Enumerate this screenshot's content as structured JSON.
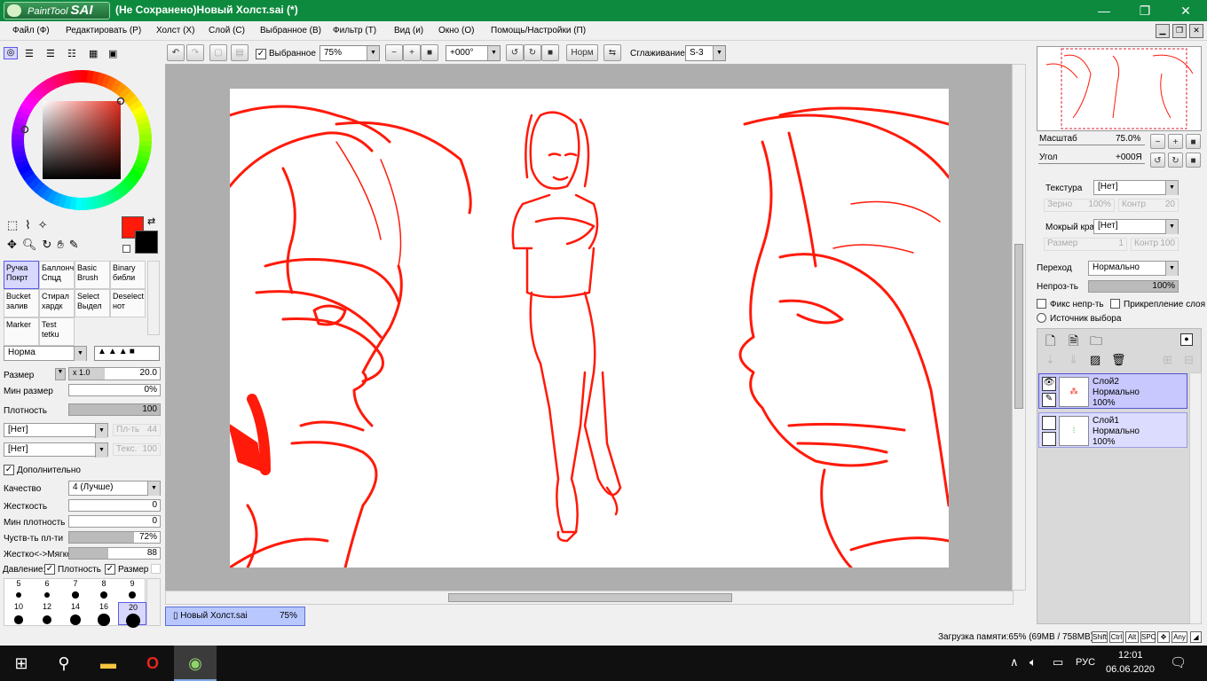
{
  "window": {
    "logo_prefix": "PaintTool",
    "logo_brand": "SAI",
    "title": "(Не Сохранено)Новый Холст.sai (*)",
    "minimize": "—",
    "maximize": "❐",
    "close": "✕"
  },
  "menu": [
    "Файл (Ф)",
    "Редактировать (Р)",
    "Холст (Х)",
    "Слой (С)",
    "Выбранное (В)",
    "Фильтр (Т)",
    "Вид (и)",
    "Окно (О)",
    "Помощь/Настройки (П)"
  ],
  "toolbar": {
    "selected_label": "Выбранное",
    "selected_checked": true,
    "zoom": "75%",
    "angle": "+000°",
    "norm_button": "Норм",
    "smoothing_label": "Сглаживание",
    "smoothing_value": "S-3"
  },
  "colors": {
    "primary": "#ff1a0a",
    "secondary": "#000000",
    "accent": "#5a5ae8",
    "titlebar": "#0e8a3e",
    "stroke": "#ff1a0a"
  },
  "tools": [
    {
      "line1": "Ручка",
      "line2": "Покрт",
      "selected": true
    },
    {
      "line1": "Баллонч",
      "line2": "Спцд"
    },
    {
      "line1": "Basic",
      "line2": "Brush"
    },
    {
      "line1": "Binary",
      "line2": "библи"
    },
    {
      "line1": "Bucket",
      "line2": "залив"
    },
    {
      "line1": "Стирал",
      "line2": "хардк"
    },
    {
      "line1": "Select",
      "line2": "Выдел"
    },
    {
      "line1": "Deselect",
      "line2": "нот"
    },
    {
      "line1": "Marker",
      "line2": ""
    },
    {
      "line1": "Test",
      "line2": "tetku"
    }
  ],
  "brush": {
    "blend_mode": "Норма",
    "size_label": "Размер",
    "size_mult": "x 1.0",
    "size_value": "20.0",
    "min_size_label": "Мин размер",
    "min_size_value": "0%",
    "density_label": "Плотность",
    "density_value": "100",
    "shape1": "[Нет]",
    "shape1_side": "Пл-ть",
    "shape1_side_val": "44",
    "texture": "[Нет]",
    "texture_side": "Текс.",
    "texture_side_val": "100",
    "advanced_label": "Дополнительно",
    "quality_label": "Качество",
    "quality_value": "4 (Лучше)",
    "hardness_label": "Жесткость",
    "hardness_value": "0",
    "min_density_label": "Мин плотность",
    "min_density_value": "0",
    "sens_label": "Чуств-ть пл-ти",
    "sens_value": "72%",
    "sens_fraction": 0.72,
    "softness_label": "Жестко<->Мягко",
    "softness_value": "88",
    "pressure_label": "Давление:",
    "pressure_density": "Плотность",
    "pressure_size": "Размер"
  },
  "brush_sizes": {
    "row1": [
      "5",
      "6",
      "7",
      "8",
      "9"
    ],
    "row2": [
      "10",
      "12",
      "14",
      "16",
      "20"
    ]
  },
  "doc_tab": {
    "name": "Новый Холст.sai",
    "zoom": "75%"
  },
  "status": {
    "memory": "Загрузка памяти:65% (69MB / 758MB)",
    "keys": [
      "Shift",
      "Ctrl",
      "Alt",
      "SPC",
      "",
      "Any"
    ]
  },
  "navigator": {
    "zoom_label": "Масштаб",
    "zoom_value": "75.0%",
    "angle_label": "Угол",
    "angle_value": "+000Я"
  },
  "layer_props": {
    "texture_label": "Текстура",
    "texture_value": "[Нет]",
    "grain_label": "Зерно",
    "grain_value": "100%",
    "contrast_label": "Контр",
    "contrast_value": "20",
    "wet_label": "Мокрый край",
    "wet_value": "[Нет]",
    "size_label": "Размер",
    "size_value": "1",
    "contr2_label": "Контр",
    "contr2_value": "100",
    "blend_label": "Переход",
    "blend_value": "Нормально",
    "opacity_label": "Непроз-ть",
    "opacity_value": "100%",
    "fix_opacity": "Фикс непр-ть",
    "clip_layer": "Прикрепление слоя",
    "selection_source": "Источник выбора"
  },
  "layers": [
    {
      "name": "Слой2",
      "mode": "Нормально",
      "opacity": "100%",
      "selected": true
    },
    {
      "name": "Слой1",
      "mode": "Нормально",
      "opacity": "100%",
      "selected": false
    }
  ],
  "taskbar": {
    "lang": "РУС",
    "time": "12:01",
    "date": "06.06.2020"
  }
}
